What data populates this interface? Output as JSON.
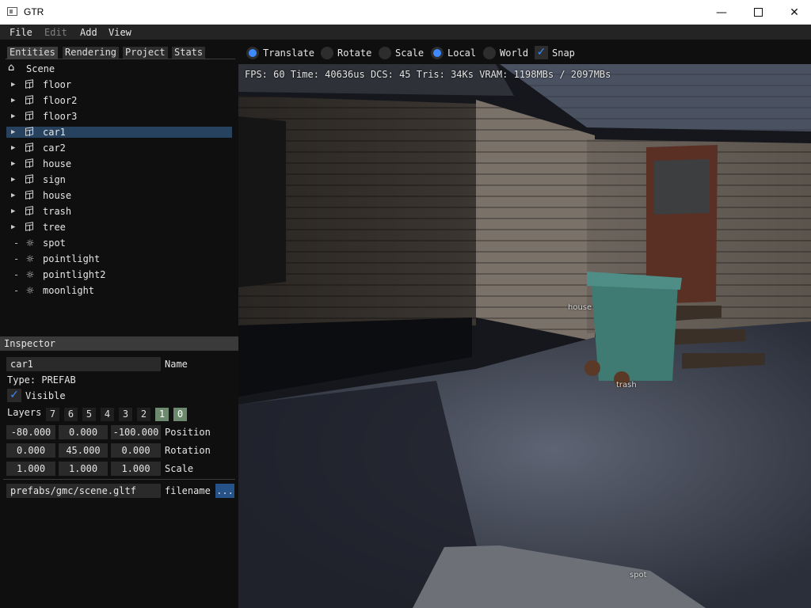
{
  "window": {
    "title": "GTR"
  },
  "menu": [
    "File",
    "Edit",
    "Add",
    "View"
  ],
  "tabs": [
    "Entities",
    "Rendering",
    "Project",
    "Stats"
  ],
  "tree": {
    "root": "Scene",
    "items": [
      {
        "label": "floor",
        "kind": "prefab"
      },
      {
        "label": "floor2",
        "kind": "prefab"
      },
      {
        "label": "floor3",
        "kind": "prefab"
      },
      {
        "label": "car1",
        "kind": "prefab",
        "selected": true
      },
      {
        "label": "car2",
        "kind": "prefab"
      },
      {
        "label": "house",
        "kind": "prefab"
      },
      {
        "label": "sign",
        "kind": "prefab"
      },
      {
        "label": "house",
        "kind": "prefab"
      },
      {
        "label": "trash",
        "kind": "prefab"
      },
      {
        "label": "tree",
        "kind": "prefab"
      },
      {
        "label": "spot",
        "kind": "light"
      },
      {
        "label": "pointlight",
        "kind": "light"
      },
      {
        "label": "pointlight2",
        "kind": "light"
      },
      {
        "label": "moonlight",
        "kind": "light"
      }
    ]
  },
  "inspector": {
    "header": "Inspector",
    "name_value": "car1",
    "name_label": "Name",
    "type_text": "Type: PREFAB",
    "visible_label": "Visible",
    "visible_checked": true,
    "layers_label": "Layers",
    "layers": [
      "7",
      "6",
      "5",
      "4",
      "3",
      "2",
      "1",
      "0"
    ],
    "layers_active": [
      "1",
      "0"
    ],
    "position": {
      "values": [
        "-80.000",
        "0.000",
        "-100.000"
      ],
      "label": "Position"
    },
    "rotation": {
      "values": [
        "0.000",
        "45.000",
        "0.000"
      ],
      "label": "Rotation"
    },
    "scale": {
      "values": [
        "1.000",
        "1.000",
        "1.000"
      ],
      "label": "Scale"
    },
    "filename_value": "prefabs/gmc/scene.gltf",
    "filename_label": "filename",
    "browse_label": "..."
  },
  "toolbar": {
    "translate": "Translate",
    "rotate": "Rotate",
    "scale": "Scale",
    "local": "Local",
    "world": "World",
    "snap": "Snap",
    "selected_operation": "Translate",
    "selected_space": "Local",
    "snap_checked": true
  },
  "viewport": {
    "stats": "FPS: 60 Time: 40636us DCS: 45 Tris: 34Ks  VRAM: 1198MBs / 2097MBs",
    "labels": {
      "house": "house",
      "trash": "trash",
      "spot": "spot"
    }
  },
  "colors": {
    "accent": "#3d8bff",
    "selection": "#26425e",
    "panel_bg": "#0f0f0f",
    "layer_on": "#6e8a6e"
  }
}
